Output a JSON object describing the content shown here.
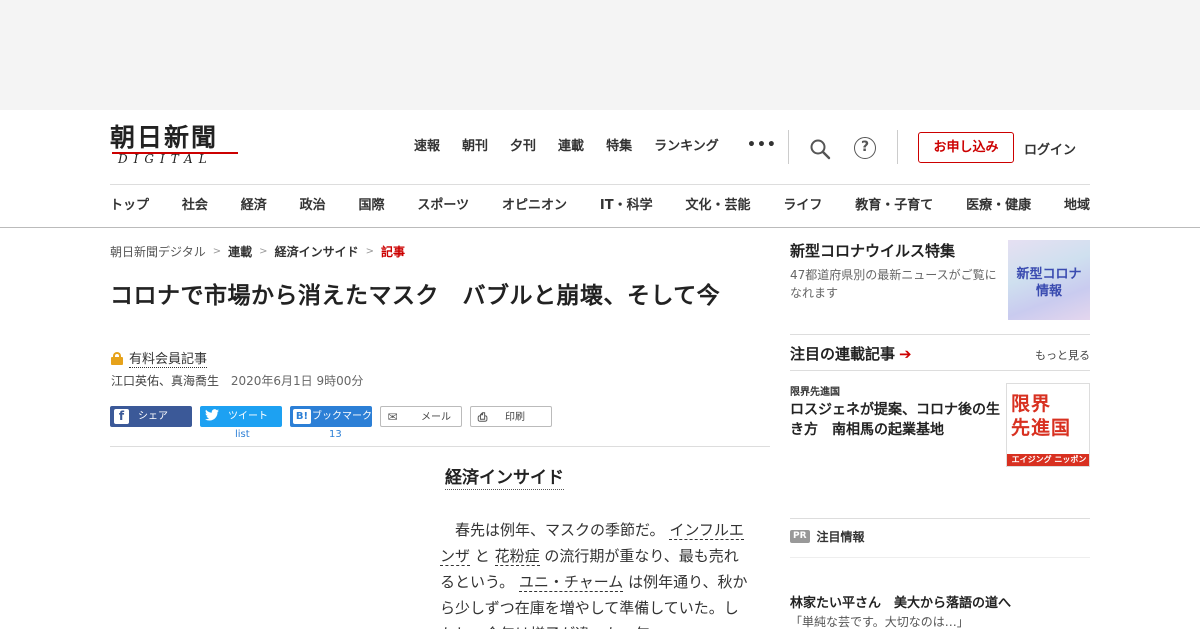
{
  "header": {
    "logo_main": "朝日新聞",
    "logo_sub": "DIGITAL",
    "top_nav": [
      "速報",
      "朝刊",
      "夕刊",
      "連載",
      "特集",
      "ランキング"
    ],
    "more_label": "•••",
    "help_label": "?",
    "apply_label": "お申し込み",
    "login_label": "ログイン",
    "category_nav": [
      "トップ",
      "社会",
      "経済",
      "政治",
      "国際",
      "スポーツ",
      "オピニオン",
      "IT・科学",
      "文化・芸能",
      "ライフ",
      "教育・子育て",
      "医療・健康",
      "地域"
    ]
  },
  "breadcrumb": {
    "home": "朝日新聞デジタル",
    "series": "連載",
    "column": "経済インサイド",
    "current": "記事",
    "separator": ">"
  },
  "article": {
    "title": "コロナで市場から消えたマスク　バブルと崩壊、そして今",
    "members_label": "有料会員記事",
    "authors": "江口英佑、真海喬生",
    "date": "2020年6月1日 9時00分",
    "series_tag": "経済インサイド",
    "body": {
      "p1_a": "　春先は例年、マスクの季節だ。",
      "link1": "インフルエンザ",
      "p1_b": "と",
      "link2": "花粉症",
      "p1_c": "の流行期が重なり、最も売れるという。",
      "link3": "ユニ・チャーム",
      "p1_d": "は例年通り、秋から少しずつ在庫を増やして準備していた。しかし、今年は様子が違った。年"
    }
  },
  "share": {
    "facebook": {
      "icon": "f",
      "label": "シェア"
    },
    "twitter": {
      "icon": "🐦",
      "label": "ツイート",
      "count": "list"
    },
    "hatena": {
      "icon": "B!",
      "label": "ブックマーク",
      "count": "13"
    },
    "mail": {
      "icon": "✉",
      "label": "メール"
    },
    "print": {
      "icon": "⎙",
      "label": "印刷"
    }
  },
  "sidebar": {
    "feature": {
      "title": "新型コロナウイルス特集",
      "desc": "47都道府県別の最新ニュースがご覧になれます",
      "thumb_text_1": "新型コロナ",
      "thumb_text_2": "情報"
    },
    "series": {
      "heading": "注目の連載記事",
      "arrow": "➔",
      "more": "もっと見る",
      "item_kicker": "限界先進国",
      "item_title": "ロスジェネが提案、コロナ後の生き方　南相馬の起業基地",
      "thumb_big_1": "限界",
      "thumb_big_2": "先進国",
      "thumb_bar": "エイジング ニッポン"
    },
    "pr": {
      "badge": "PR",
      "label": "注目情報",
      "title": "林家たい平さん　美大から落語の道へ",
      "desc": "「単純な芸です。大切なのは…」"
    }
  },
  "colors": {
    "accent_red": "#cc0000",
    "facebook": "#3b5998",
    "twitter": "#1da1f2",
    "hatena": "#2c7fd6",
    "lock": "#e6a21a"
  }
}
